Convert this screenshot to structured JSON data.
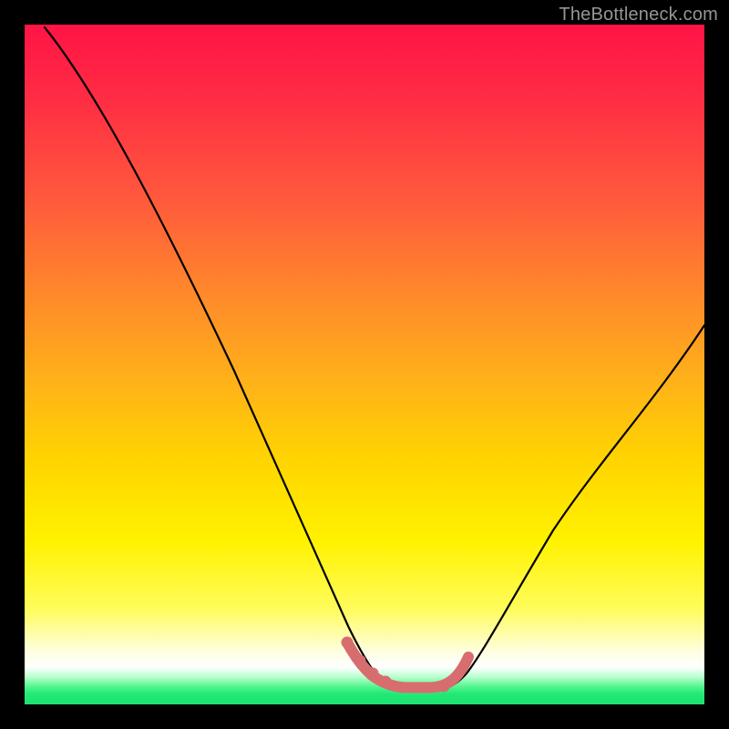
{
  "watermark": "TheBottleneck.com",
  "chart_data": {
    "type": "line",
    "title": "",
    "xlabel": "",
    "ylabel": "",
    "xlim": [
      0,
      100
    ],
    "ylim": [
      0,
      100
    ],
    "grid": false,
    "legend": false,
    "note": "Values estimated from pixel positions; axes unlabeled in source image. x is normalized 0-100 left-to-right across the plot area, y is 0 at bottom and 100 at top. Two continuous black curves meet near the bottom; a short salmon segment with dots overlays the trough.",
    "series": [
      {
        "name": "left-curve",
        "x": [
          3,
          10,
          18,
          25,
          32,
          38,
          43,
          47,
          50.5,
          53,
          55
        ],
        "values": [
          99.5,
          88,
          73,
          58,
          42,
          28,
          17,
          9,
          4.5,
          2.8,
          2.4
        ]
      },
      {
        "name": "right-curve",
        "x": [
          62,
          64,
          66,
          69,
          73,
          78,
          84,
          90,
          96,
          100
        ],
        "values": [
          2.8,
          4.2,
          7,
          12,
          20,
          29,
          38,
          46,
          52,
          56
        ]
      },
      {
        "name": "trough-highlight",
        "color": "#d76d6f",
        "x": [
          47.5,
          49.5,
          51.5,
          53.5,
          56,
          59,
          61.5,
          63.5,
          64.5
        ],
        "values": [
          9.2,
          6.5,
          4.6,
          3.4,
          2.6,
          2.6,
          3.4,
          5.2,
          7.4
        ]
      }
    ],
    "markers": {
      "series": "trough-highlight",
      "indices": [
        0,
        1,
        2,
        3,
        7,
        8
      ],
      "radius_px": 6
    }
  }
}
